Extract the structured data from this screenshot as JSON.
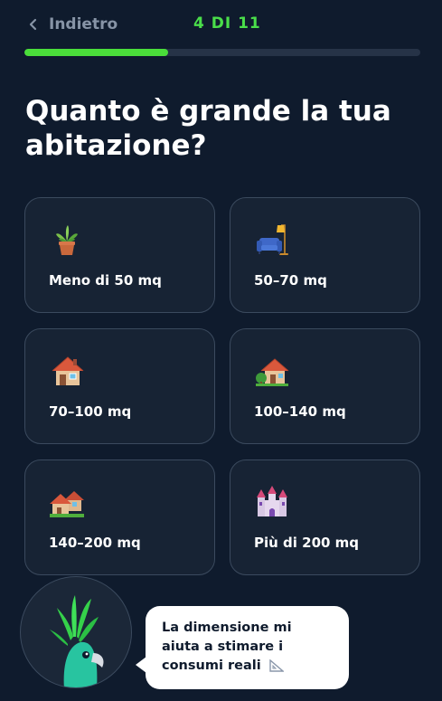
{
  "header": {
    "back_label": "Indietro",
    "step_label": "4 DI 11",
    "progress": 0.364
  },
  "question": {
    "title": "Quanto è grande la tua abitazione?"
  },
  "options": [
    {
      "label": "Meno di 50 mq",
      "icon": "potted-plant-icon"
    },
    {
      "label": "50–70 mq",
      "icon": "sofa-lamp-icon"
    },
    {
      "label": "70–100 mq",
      "icon": "house-icon"
    },
    {
      "label": "100–140 mq",
      "icon": "house-with-garden-icon"
    },
    {
      "label": "140–200 mq",
      "icon": "houses-icon"
    },
    {
      "label": "Più di 200 mq",
      "icon": "castle-icon"
    }
  ],
  "assistant": {
    "message": "La dimensione mi aiuta a stimare i consumi reali",
    "icon": "triangular-ruler-icon",
    "avatar_icon": "cockatoo-mascot-icon"
  },
  "colors": {
    "background": "#0f1b2d",
    "accent": "#4ade3a",
    "card_border": "#3b4a5e",
    "card_bg": "#172334"
  }
}
